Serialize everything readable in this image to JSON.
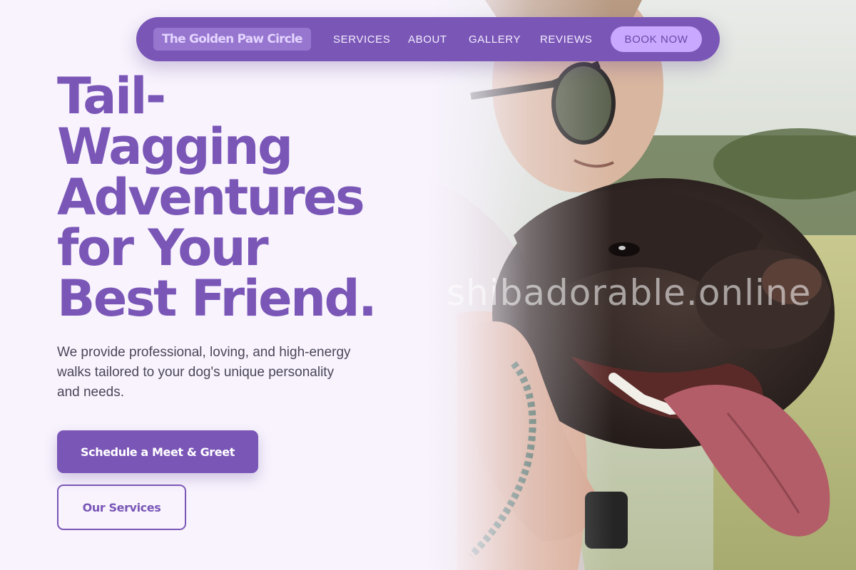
{
  "nav": {
    "brand": "The Golden Paw Circle",
    "links": [
      "SERVICES",
      "ABOUT",
      "GALLERY",
      "REVIEWS"
    ],
    "cta": "BOOK NOW"
  },
  "hero": {
    "title_lines": [
      "Tail-",
      "Wagging",
      "Adventures",
      "for Your",
      "Best Friend."
    ],
    "description": "We provide professional, loving, and high-energy walks tailored to your dog's unique personality and needs.",
    "primary_button": "Schedule a Meet & Greet",
    "secondary_button": "Our Services"
  },
  "photo": {
    "subject": "woman-hugging-dog-photo",
    "watermark": "shibadorable.online"
  },
  "colors": {
    "brand_purple": "#7a56b7",
    "cta_lavender": "#c9a9ff",
    "page_background": "#f8f3fd"
  }
}
